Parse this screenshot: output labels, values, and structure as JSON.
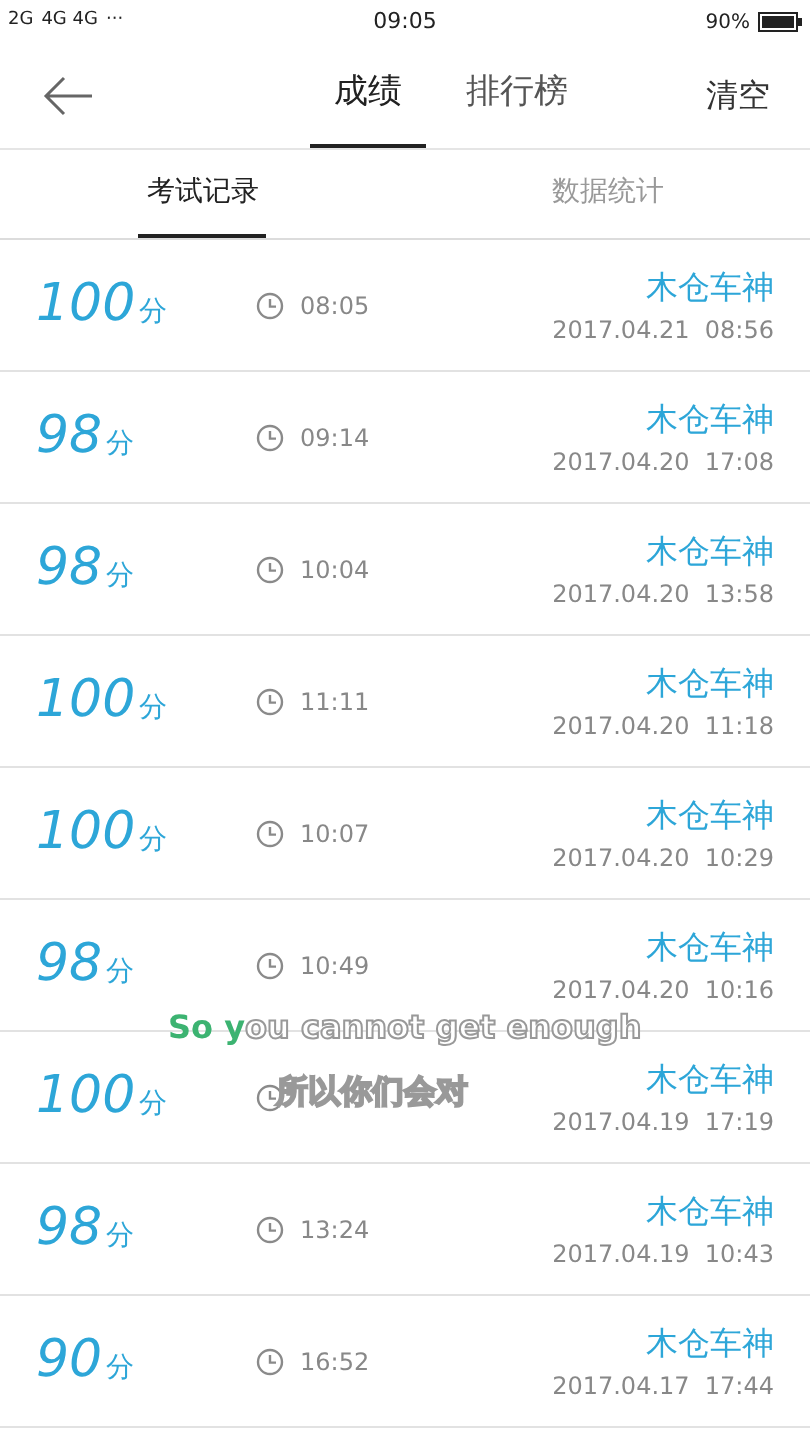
{
  "status_bar": {
    "signal_1": "2G",
    "signal_2": "4G 4G",
    "dots": "···",
    "time": "09:05",
    "battery": "90%"
  },
  "header": {
    "tabs": [
      {
        "label": "成绩",
        "selected": true
      },
      {
        "label": "排行榜",
        "selected": false
      }
    ],
    "action": "清空"
  },
  "sub_tabs": [
    {
      "label": "考试记录",
      "selected": true
    },
    {
      "label": "数据统计",
      "selected": false
    }
  ],
  "records": [
    {
      "score": "100",
      "unit": "分",
      "duration": "08:05",
      "name": "木仓车神",
      "date": "2017.04.21  08:56"
    },
    {
      "score": "98",
      "unit": "分",
      "duration": "09:14",
      "name": "木仓车神",
      "date": "2017.04.20  17:08"
    },
    {
      "score": "98",
      "unit": "分",
      "duration": "10:04",
      "name": "木仓车神",
      "date": "2017.04.20  13:58"
    },
    {
      "score": "100",
      "unit": "分",
      "duration": "11:11",
      "name": "木仓车神",
      "date": "2017.04.20  11:18"
    },
    {
      "score": "100",
      "unit": "分",
      "duration": "10:07",
      "name": "木仓车神",
      "date": "2017.04.20  10:29"
    },
    {
      "score": "98",
      "unit": "分",
      "duration": "10:49",
      "name": "木仓车神",
      "date": "2017.04.20  10:16"
    },
    {
      "score": "100",
      "unit": "分",
      "name": "木仓车神",
      "date": "2017.04.19  17:19"
    },
    {
      "score": "98",
      "unit": "分",
      "duration": "13:24",
      "name": "木仓车神",
      "date": "2017.04.19  10:43"
    },
    {
      "score": "90",
      "unit": "分",
      "duration": "16:52",
      "name": "木仓车神",
      "date": "2017.04.17  17:44"
    }
  ],
  "lyrics": {
    "sung": "So y",
    "unsung": "ou cannot get enough",
    "translation": "所以你们会对"
  }
}
